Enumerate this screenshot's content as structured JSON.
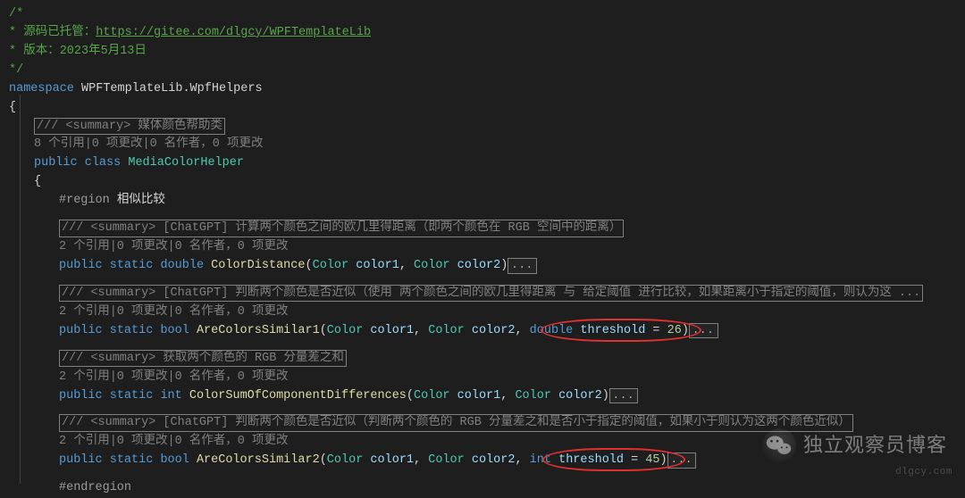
{
  "header": {
    "comment_open": "/*",
    "line1_prefix": " * 源码已托管：",
    "url": "https://gitee.com/dlgcy/WPFTemplateLib",
    "line2": " * 版本：2023年5月13日",
    "line3": " */",
    "ns_kw": "namespace",
    "ns_name": "WPFTemplateLib.WpfHelpers",
    "brace_open": "{",
    "brace_close": "}"
  },
  "class": {
    "summary_box": "/// <summary> 媒体颜色帮助类",
    "codelens": "8 个引用|0 项更改|0 名作者，0 项更改",
    "public": "public",
    "class_kw": "class",
    "name": "MediaColorHelper",
    "brace_open": "{",
    "region_kw": "#region",
    "region_name": "相似比较",
    "endregion": "#endregion"
  },
  "m1": {
    "summary_box": "/// <summary> [ChatGPT] 计算两个颜色之间的欧几里得距离（即两个颜色在 RGB 空间中的距离）",
    "codelens": "2 个引用|0 项更改|0 名作者，0 项更改",
    "public": "public",
    "static": "static",
    "ret": "double",
    "name": "ColorDistance",
    "p_open": "(",
    "t1": "Color",
    "a1": "color1",
    "comma": ", ",
    "t2": "Color",
    "a2": "color2",
    "p_close": ")",
    "collapse": "..."
  },
  "m2": {
    "summary_box": "/// <summary> [ChatGPT] 判断两个颜色是否近似（使用 两个颜色之间的欧几里得距离 与 给定阈值 进行比较，如果距离小于指定的阈值，则认为这 ...",
    "codelens": "2 个引用|0 项更改|0 名作者，0 项更改",
    "public": "public",
    "static": "static",
    "ret": "bool",
    "name": "AreColorsSimilar1",
    "p_open": "(",
    "t1": "Color",
    "a1": "color1",
    "comma1": ", ",
    "t2": "Color",
    "a2": "color2",
    "comma2": ", ",
    "t3": "double",
    "a3": "threshold",
    "eq": " = ",
    "def": "26",
    "p_close": ")",
    "collapse": "..."
  },
  "m3": {
    "summary_box": "/// <summary> 获取两个颜色的 RGB 分量差之和",
    "codelens": "2 个引用|0 项更改|0 名作者，0 项更改",
    "public": "public",
    "static": "static",
    "ret": "int",
    "name": "ColorSumOfComponentDifferences",
    "p_open": "(",
    "t1": "Color",
    "a1": "color1",
    "comma": ", ",
    "t2": "Color",
    "a2": "color2",
    "p_close": ")",
    "collapse": "..."
  },
  "m4": {
    "summary_box": "/// <summary> [ChatGPT] 判断两个颜色是否近似（判断两个颜色的 RGB 分量差之和是否小于指定的阈值，如果小于则认为这两个颜色近似）",
    "codelens": "2 个引用|0 项更改|0 名作者，0 项更改",
    "public": "public",
    "static": "static",
    "ret": "bool",
    "name": "AreColorsSimilar2",
    "p_open": "(",
    "t1": "Color",
    "a1": "color1",
    "comma1": ", ",
    "t2": "Color",
    "a2": "color2",
    "comma2": ", ",
    "t3": "int",
    "a3": "threshold",
    "eq": " = ",
    "def": "45",
    "p_close": ")",
    "collapse": "..."
  },
  "watermark": {
    "text": "独立观察员博客",
    "url": "dlgcy.com"
  }
}
